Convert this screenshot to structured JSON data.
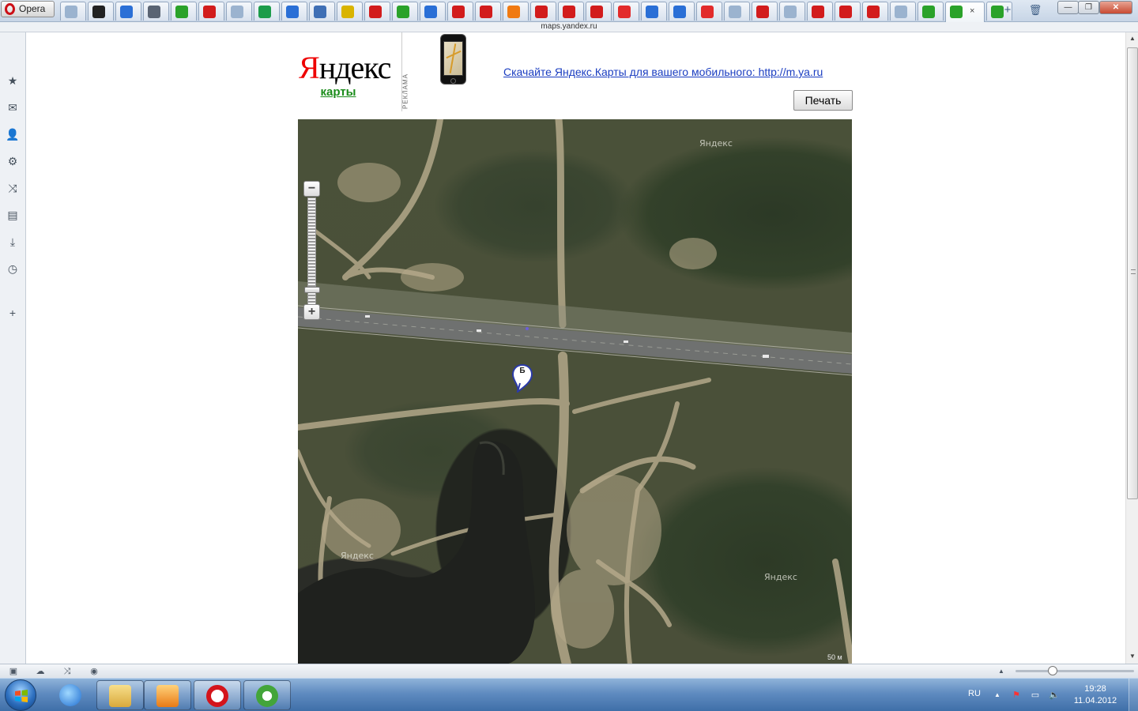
{
  "browser": {
    "menu_label": "Opera",
    "address_text": "maps.yandex.ru",
    "tabs": [
      {
        "icon": "generic-page-icon",
        "color": "#9bb3cf"
      },
      {
        "icon": "circle-ring-icon",
        "color": "#222222"
      },
      {
        "icon": "translate-icon",
        "color": "#2a6fd6"
      },
      {
        "icon": "magnet-icon",
        "color": "#5a6473"
      },
      {
        "icon": "green-circle-icon",
        "color": "#2aa22a"
      },
      {
        "icon": "red-u-icon",
        "color": "#d21c1c"
      },
      {
        "icon": "generic-page-icon",
        "color": "#9bb3cf"
      },
      {
        "icon": "green-table-icon",
        "color": "#1c9c4a"
      },
      {
        "icon": "blue-pattern-icon",
        "color": "#2a6fd6"
      },
      {
        "icon": "document-icon",
        "color": "#3f6fb5"
      },
      {
        "icon": "yellow-chain-icon",
        "color": "#d9b400"
      },
      {
        "icon": "shopping-cart-icon",
        "color": "#d21c1c"
      },
      {
        "icon": "green-circle-icon",
        "color": "#2aa22a"
      },
      {
        "icon": "gear-blue-icon",
        "color": "#2a6fd6"
      },
      {
        "icon": "red-u-icon",
        "color": "#d21c1c"
      },
      {
        "icon": "shopping-cart-icon",
        "color": "#d21c1c"
      },
      {
        "icon": "orange-b-icon",
        "color": "#f07a12"
      },
      {
        "icon": "shopping-cart-icon",
        "color": "#d21c1c"
      },
      {
        "icon": "shopping-cart-icon",
        "color": "#d21c1c"
      },
      {
        "icon": "shopping-cart-icon",
        "color": "#d21c1c"
      },
      {
        "icon": "yandex-y-icon",
        "color": "#e22b2b"
      },
      {
        "icon": "blue-square-icon",
        "color": "#2a6fd6"
      },
      {
        "icon": "puzzle-icon",
        "color": "#2a6fd6"
      },
      {
        "icon": "yandex-y-icon",
        "color": "#e22b2b"
      },
      {
        "icon": "generic-page-icon",
        "color": "#9bb3cf"
      },
      {
        "icon": "shopping-cart-icon",
        "color": "#d21c1c"
      },
      {
        "icon": "generic-page-icon",
        "color": "#9bb3cf"
      },
      {
        "icon": "shopping-cart-icon",
        "color": "#d21c1c"
      },
      {
        "icon": "shopping-cart-icon",
        "color": "#d21c1c"
      },
      {
        "icon": "shopping-cart-icon",
        "color": "#d21c1c"
      },
      {
        "icon": "generic-page-icon",
        "color": "#9bb3cf"
      },
      {
        "icon": "green-circle-icon",
        "color": "#2aa22a"
      },
      {
        "icon": "green-circle-icon",
        "color": "#2aa22a",
        "active": true
      },
      {
        "icon": "green-circle-icon",
        "color": "#2aa22a"
      }
    ],
    "close_tab_glyph": "×",
    "new_tab_glyph": "+",
    "trash_glyph": "🗑",
    "window_buttons": {
      "minimize": "—",
      "maximize": "❐",
      "close": "✕"
    }
  },
  "side_panel": [
    {
      "icon": "bookmarks-star-icon",
      "glyph": "★"
    },
    {
      "icon": "mail-icon",
      "glyph": "✉"
    },
    {
      "icon": "contacts-icon",
      "glyph": "👤"
    },
    {
      "icon": "settings-gear-icon",
      "glyph": "⚙"
    },
    {
      "icon": "unite-share-icon",
      "glyph": "⤨"
    },
    {
      "icon": "notes-icon",
      "glyph": "▤"
    },
    {
      "icon": "downloads-icon",
      "glyph": "⤓"
    },
    {
      "icon": "history-clock-icon",
      "glyph": "◷"
    },
    {
      "icon": "add-panel-icon",
      "glyph": "+"
    }
  ],
  "page": {
    "logo_first_letter": "Я",
    "logo_rest": "ндекс",
    "logo_link": "карты",
    "ad_label": "РЕКЛАМА",
    "ad_link_text": "Скачайте Яндекс.Карты для вашего мобильного: http://m.ya.ru",
    "print_button": "Печать",
    "map": {
      "watermarks": [
        "Яндекс",
        "Яндекс",
        "Яндекс"
      ],
      "marker_label": "Б",
      "scale_text": "50 м",
      "zoom_in": "+",
      "zoom_out": "−",
      "zoom_level_fraction": 0.88
    }
  },
  "statusbar": {
    "icons": [
      "panel-toggle-icon",
      "cloud-icon",
      "unite-icon",
      "speed-dial-icon"
    ],
    "zoom_fraction": 0.3,
    "up_arrow": "▲"
  },
  "taskbar": {
    "apps": [
      {
        "name": "internet-explorer-icon",
        "color": "#2f7ad6"
      },
      {
        "name": "file-explorer-icon",
        "color": "#e8c25a"
      },
      {
        "name": "media-player-icon",
        "color": "#f08a1e"
      },
      {
        "name": "opera-browser-icon",
        "color": "#d4141b"
      },
      {
        "name": "utorrent-icon",
        "color": "#43a53a"
      }
    ],
    "lang": "RU",
    "tray_arrow": "▲",
    "clock_time": "19:28",
    "clock_date": "11.04.2012"
  }
}
